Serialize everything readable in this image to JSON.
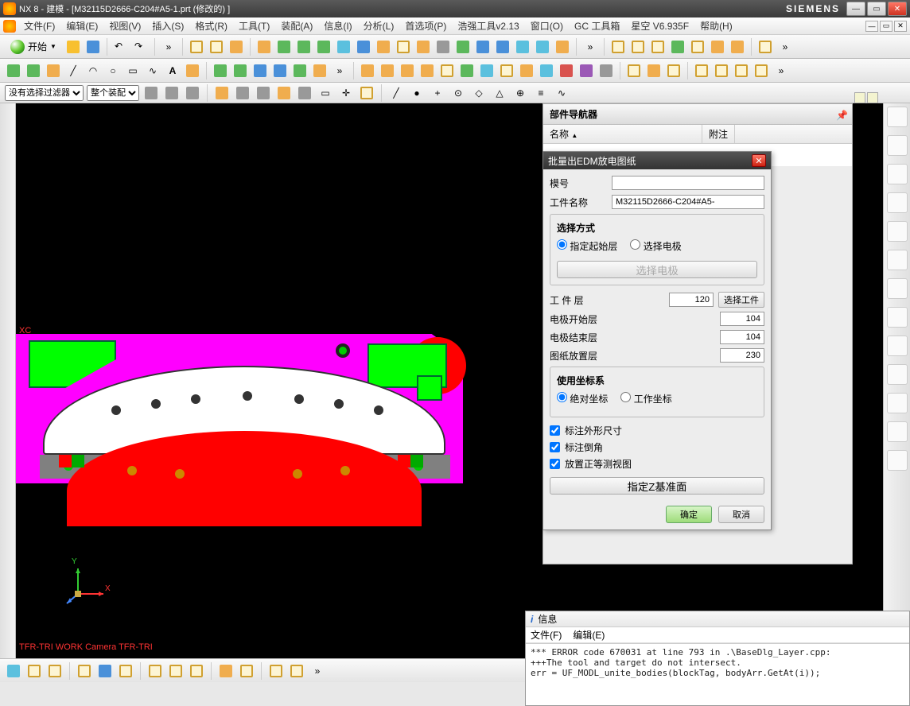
{
  "title": {
    "app": "NX 8 - 建模",
    "doc": "[M32115D2666-C204#A5-1.prt  (修改的)  ]",
    "brand": "SIEMENS"
  },
  "menus": [
    "文件(F)",
    "编辑(E)",
    "视图(V)",
    "插入(S)",
    "格式(R)",
    "工具(T)",
    "装配(A)",
    "信息(I)",
    "分析(L)",
    "首选项(P)",
    "浩强工具v2.13",
    "窗口(O)",
    "GC 工具箱",
    "星空 V6.935F",
    "帮助(H)"
  ],
  "start_label": "开始",
  "filter": {
    "no_filter": "没有选择过滤器",
    "assembly_scope": "整个装配"
  },
  "navigator": {
    "title": "部件导航器",
    "col_name": "名称",
    "col_note": "附注"
  },
  "dialog": {
    "title": "批量出EDM放电图纸",
    "model_no_label": "模号",
    "model_no_value": "",
    "part_name_label": "工件名称",
    "part_name_value": "M32115D2666-C204#A5-",
    "select_mode_title": "选择方式",
    "radio_start_layer": "指定起始层",
    "radio_select_electrode": "选择电极",
    "select_electrode_btn": "选择电极",
    "work_layer_label": "工 件 层",
    "work_layer_value": "120",
    "select_work_btn": "选择工件",
    "elec_start_label": "电极开始层",
    "elec_start_value": "104",
    "elec_end_label": "电极结束层",
    "elec_end_value": "104",
    "drawing_layer_label": "图纸放置层",
    "drawing_layer_value": "230",
    "coord_title": "使用坐标系",
    "radio_abs": "绝对坐标",
    "radio_work": "工作坐标",
    "chk_outline": "标注外形尺寸",
    "chk_chamfer": "标注倒角",
    "chk_iso": "放置正等测视图",
    "specify_z_btn": "指定Z基准面",
    "ok": "确定",
    "cancel": "取消"
  },
  "viewport": {
    "xc": "XC",
    "camera": "TFR-TRI WORK Camera TFR-TRI",
    "axis_x": "X",
    "axis_y": "Y"
  },
  "info": {
    "title": "信息",
    "menu_file": "文件(F)",
    "menu_edit": "编辑(E)",
    "line1": "*** ERROR code 670031 at line 793 in .\\BaseDlg_Layer.cpp:",
    "line2": "+++The tool and target do not intersect.",
    "line3": "err = UF_MODL_unite_bodies(blockTag, bodyArr.GetAt(i));"
  }
}
